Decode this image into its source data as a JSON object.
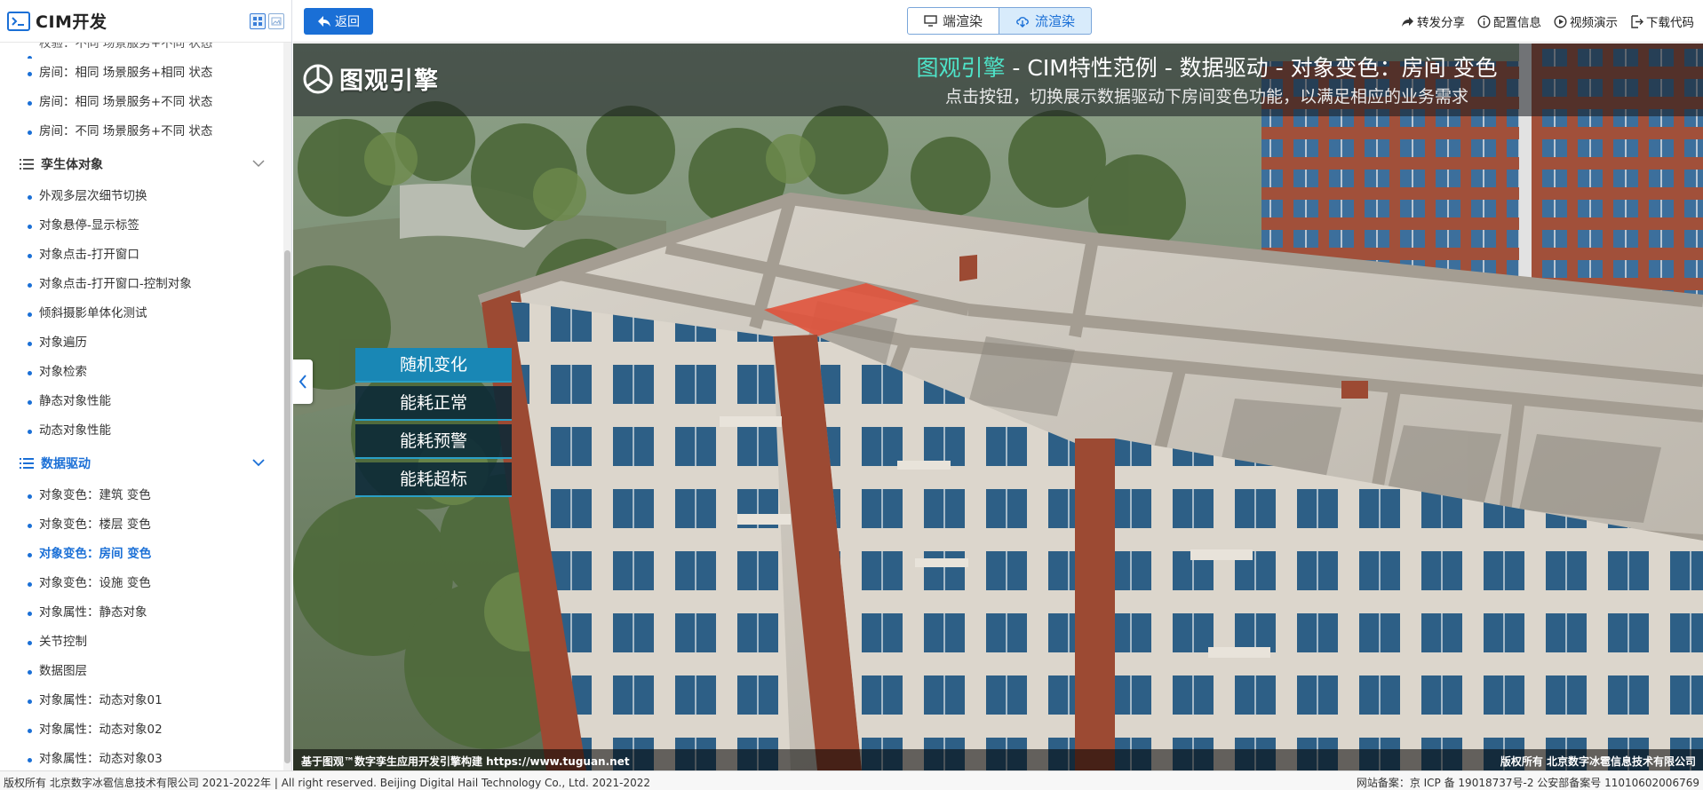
{
  "sidebar": {
    "title": "CIM开发",
    "top_items": [
      {
        "label": "校验：不同 场景服务+不同 状态"
      },
      {
        "label": "房间：相同 场景服务+相同 状态"
      },
      {
        "label": "房间：相同 场景服务+不同 状态"
      },
      {
        "label": "房间：不同 场景服务+不同 状态"
      }
    ],
    "group_twin": {
      "label": "孪生体对象",
      "items": [
        {
          "label": "外观多层次细节切换"
        },
        {
          "label": "对象悬停-显示标签"
        },
        {
          "label": "对象点击-打开窗口"
        },
        {
          "label": "对象点击-打开窗口-控制对象"
        },
        {
          "label": "倾斜摄影单体化测试"
        },
        {
          "label": "对象遍历"
        },
        {
          "label": "对象检索"
        },
        {
          "label": "静态对象性能"
        },
        {
          "label": "动态对象性能"
        }
      ]
    },
    "group_data": {
      "label": "数据驱动",
      "items": [
        {
          "label": "对象变色：建筑 变色"
        },
        {
          "label": "对象变色：楼层 变色"
        },
        {
          "label": "对象变色：房间 变色",
          "active": true
        },
        {
          "label": "对象变色：设施 变色"
        },
        {
          "label": "对象属性：静态对象"
        },
        {
          "label": "关节控制"
        },
        {
          "label": "数据图层"
        },
        {
          "label": "对象属性：动态对象01"
        },
        {
          "label": "对象属性：动态对象02"
        },
        {
          "label": "对象属性：动态对象03"
        }
      ]
    }
  },
  "topbar": {
    "back_label": "返回",
    "render_client": "端渲染",
    "render_stream": "流渲染",
    "tools": [
      {
        "label": "转发分享",
        "icon": "share-icon"
      },
      {
        "label": "配置信息",
        "icon": "info-icon"
      },
      {
        "label": "视频演示",
        "icon": "play-icon"
      },
      {
        "label": "下载代码",
        "icon": "download-icon"
      }
    ]
  },
  "scene": {
    "brand": "图观引擎",
    "title_highlight": "图观引擎",
    "title_rest": " - CIM特性范例 - 数据驱动 - 对象变色：房间 变色",
    "subtitle": "点击按钮，切换展示数据驱动下房间变色功能，以满足相应的业务需求",
    "buttons": [
      {
        "label": "随机变化",
        "active": true
      },
      {
        "label": "能耗正常"
      },
      {
        "label": "能耗预警"
      },
      {
        "label": "能耗超标"
      }
    ],
    "footer_left": "基于图观™数字孪生应用开发引擎构建 https://www.tuguan.net",
    "footer_right": "版权所有 北京数字冰雹信息技术有限公司"
  },
  "status": {
    "left": "版权所有 北京数字冰雹信息技术有限公司 2021-2022年 | All right reserved. Beijing Digital Hail Technology Co., Ltd. 2021-2022",
    "right": "网站备案：京 ICP 备 19018737号-2 公安部备案号 11010602006769"
  },
  "colors": {
    "primary": "#1a6fd6",
    "highlight_room": "#e0533c",
    "control_active": "#1987b5"
  }
}
